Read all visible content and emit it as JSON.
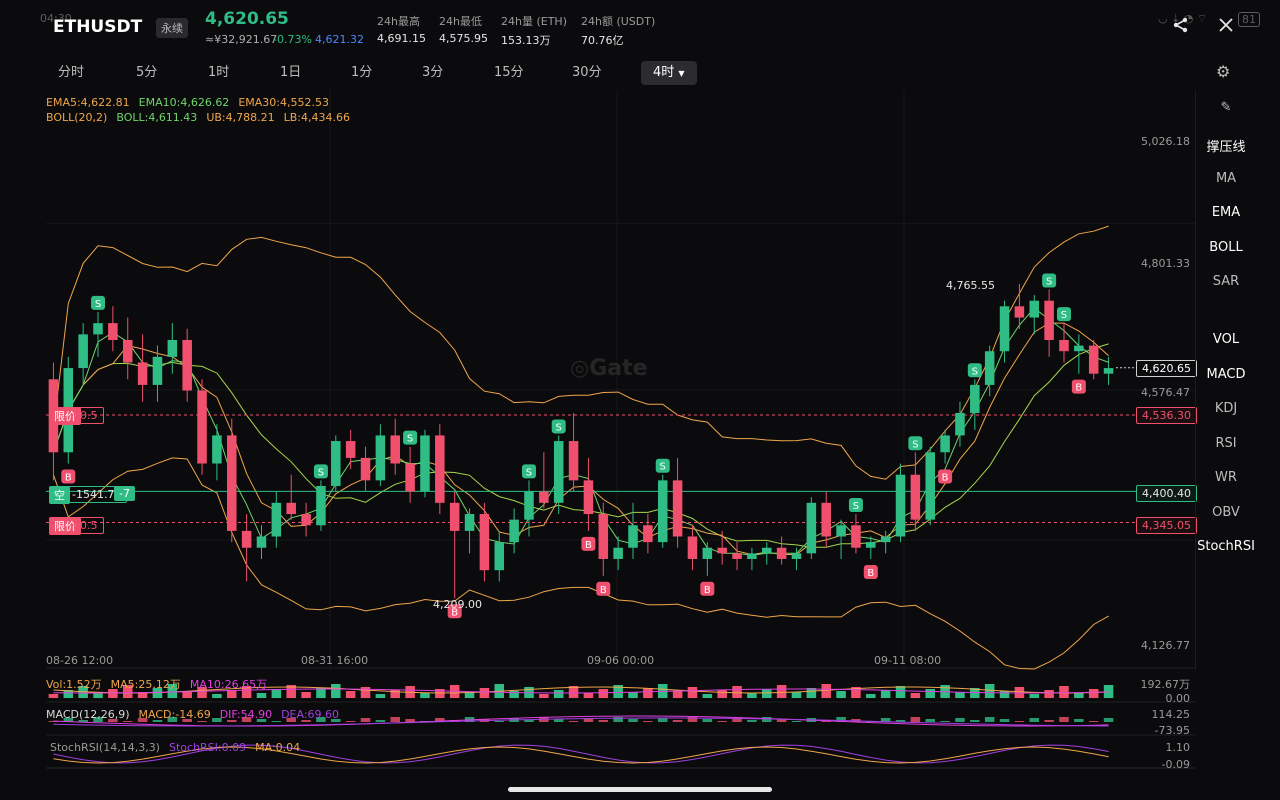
{
  "header": {
    "time": "04:30",
    "symbol": "ETHUSDT",
    "type_badge": "永续",
    "price": "4,620.65",
    "cny": "≈¥32,921.67",
    "change_pct": "-0.73%",
    "mark_price": "4,621.32",
    "stats": [
      {
        "label": "24h最高",
        "value": "4,691.15"
      },
      {
        "label": "24h最低",
        "value": "4,575.95"
      },
      {
        "label": "24h量 (ETH)",
        "value": "153.13万"
      },
      {
        "label": "24h额 (USDT)",
        "value": "70.76亿"
      }
    ],
    "battery": "81"
  },
  "timeframes": [
    "分时",
    "5分",
    "1时",
    "1日",
    "1分",
    "3分",
    "15分",
    "30分",
    "4时"
  ],
  "active_timeframe": "4时",
  "side_tools": [
    "撑压线",
    "MA",
    "EMA",
    "BOLL",
    "SAR",
    "VOL",
    "MACD",
    "KDJ",
    "RSI",
    "WR",
    "OBV",
    "StochRSI"
  ],
  "legends": {
    "ema": [
      "EMA5:4,622.81",
      "EMA10:4,626.62",
      "EMA30:4,552.53"
    ],
    "boll": [
      "BOLL(20,2)",
      "BOLL:4,611.43",
      "UB:4,788.21",
      "LB:4,434.66"
    ],
    "vol": [
      "Vol:1.52万",
      "MA5:25.12万",
      "MA10:26.65万"
    ],
    "macd": [
      "MACD(12,26,9)",
      "MACD:-14.69",
      "DIF:54.90",
      "DEA:69.60"
    ],
    "stoch": [
      "StochRSI(14,14,3,3)",
      "StochRSI:0.09",
      "MA:0.04"
    ]
  },
  "price_axis": [
    "5,026.18",
    "4,801.33",
    "4,576.47",
    "4,126.77"
  ],
  "price_tags": {
    "last": "4,620.65",
    "order_top": "4,536.30",
    "position": "4,400.40",
    "order_bottom": "4,345.05"
  },
  "orders": {
    "limit_label": "限价",
    "limit_qty": "0.5",
    "short_label": "空",
    "short_pnl": "-1541.73",
    "short_qty": "-7"
  },
  "annotations": {
    "high": "4,765.55",
    "low": "4,209.00"
  },
  "time_axis": [
    "08-26 12:00",
    "08-31 16:00",
    "09-06 00:00",
    "09-11 08:00"
  ],
  "vol_axis": [
    "192.67万",
    "0.00"
  ],
  "macd_axis": [
    "114.25",
    "-73.95"
  ],
  "stoch_axis": [
    "1.10",
    "-0.09"
  ],
  "watermark": "Gate",
  "colors": {
    "up": "#2fbd85",
    "down": "#f0506e",
    "ema5": "#f0a64a",
    "ema10": "#6fd66a",
    "boll": "#f0a64a",
    "macd_dif": "#e040e0",
    "stoch": "#a040e0"
  },
  "chart_data": {
    "type": "candlestick",
    "ylim": [
      4126.77,
      5026.18
    ],
    "candles": [
      [
        4600,
        4630,
        4420,
        4470
      ],
      [
        4470,
        4640,
        4450,
        4620
      ],
      [
        4620,
        4700,
        4590,
        4680
      ],
      [
        4680,
        4720,
        4640,
        4700
      ],
      [
        4700,
        4730,
        4650,
        4670
      ],
      [
        4670,
        4710,
        4600,
        4630
      ],
      [
        4630,
        4680,
        4560,
        4590
      ],
      [
        4590,
        4660,
        4560,
        4640
      ],
      [
        4640,
        4700,
        4610,
        4670
      ],
      [
        4670,
        4690,
        4560,
        4580
      ],
      [
        4580,
        4600,
        4430,
        4450
      ],
      [
        4450,
        4520,
        4420,
        4500
      ],
      [
        4500,
        4530,
        4310,
        4330
      ],
      [
        4330,
        4360,
        4240,
        4300
      ],
      [
        4300,
        4340,
        4280,
        4320
      ],
      [
        4320,
        4400,
        4300,
        4380
      ],
      [
        4380,
        4430,
        4350,
        4360
      ],
      [
        4360,
        4380,
        4320,
        4340
      ],
      [
        4340,
        4420,
        4330,
        4410
      ],
      [
        4410,
        4500,
        4400,
        4490
      ],
      [
        4490,
        4510,
        4440,
        4460
      ],
      [
        4460,
        4480,
        4400,
        4420
      ],
      [
        4420,
        4520,
        4410,
        4500
      ],
      [
        4500,
        4530,
        4430,
        4450
      ],
      [
        4450,
        4480,
        4380,
        4400
      ],
      [
        4400,
        4510,
        4390,
        4500
      ],
      [
        4500,
        4520,
        4360,
        4380
      ],
      [
        4380,
        4400,
        4210,
        4330
      ],
      [
        4330,
        4370,
        4290,
        4360
      ],
      [
        4360,
        4380,
        4240,
        4260
      ],
      [
        4260,
        4330,
        4240,
        4310
      ],
      [
        4310,
        4370,
        4290,
        4350
      ],
      [
        4350,
        4420,
        4320,
        4400
      ],
      [
        4400,
        4470,
        4370,
        4380
      ],
      [
        4380,
        4500,
        4360,
        4490
      ],
      [
        4490,
        4540,
        4400,
        4420
      ],
      [
        4420,
        4460,
        4330,
        4360
      ],
      [
        4360,
        4380,
        4250,
        4280
      ],
      [
        4280,
        4320,
        4260,
        4300
      ],
      [
        4300,
        4380,
        4280,
        4340
      ],
      [
        4340,
        4360,
        4290,
        4310
      ],
      [
        4310,
        4430,
        4300,
        4420
      ],
      [
        4420,
        4460,
        4300,
        4320
      ],
      [
        4320,
        4340,
        4260,
        4280
      ],
      [
        4280,
        4310,
        4250,
        4300
      ],
      [
        4300,
        4330,
        4270,
        4290
      ],
      [
        4290,
        4310,
        4260,
        4280
      ],
      [
        4280,
        4300,
        4260,
        4290
      ],
      [
        4290,
        4310,
        4270,
        4300
      ],
      [
        4300,
        4320,
        4270,
        4280
      ],
      [
        4280,
        4300,
        4260,
        4290
      ],
      [
        4290,
        4390,
        4280,
        4380
      ],
      [
        4380,
        4400,
        4300,
        4320
      ],
      [
        4320,
        4350,
        4280,
        4340
      ],
      [
        4340,
        4360,
        4290,
        4300
      ],
      [
        4300,
        4320,
        4280,
        4310
      ],
      [
        4310,
        4330,
        4290,
        4320
      ],
      [
        4320,
        4450,
        4310,
        4430
      ],
      [
        4430,
        4470,
        4330,
        4350
      ],
      [
        4350,
        4480,
        4340,
        4470
      ],
      [
        4470,
        4510,
        4450,
        4500
      ],
      [
        4500,
        4560,
        4480,
        4540
      ],
      [
        4540,
        4600,
        4510,
        4590
      ],
      [
        4590,
        4660,
        4570,
        4650
      ],
      [
        4650,
        4740,
        4630,
        4730
      ],
      [
        4730,
        4770,
        4690,
        4710
      ],
      [
        4710,
        4750,
        4680,
        4740
      ],
      [
        4740,
        4760,
        4640,
        4670
      ],
      [
        4670,
        4700,
        4630,
        4650
      ],
      [
        4650,
        4680,
        4610,
        4660
      ],
      [
        4660,
        4670,
        4600,
        4610
      ],
      [
        4610,
        4640,
        4590,
        4620
      ]
    ],
    "signals": [
      {
        "i": 3,
        "t": "S"
      },
      {
        "i": 1,
        "t": "B"
      },
      {
        "i": 18,
        "t": "S"
      },
      {
        "i": 24,
        "t": "S"
      },
      {
        "i": 27,
        "t": "B"
      },
      {
        "i": 32,
        "t": "S"
      },
      {
        "i": 34,
        "t": "S"
      },
      {
        "i": 36,
        "t": "B"
      },
      {
        "i": 37,
        "t": "B"
      },
      {
        "i": 41,
        "t": "S"
      },
      {
        "i": 44,
        "t": "B"
      },
      {
        "i": 54,
        "t": "S"
      },
      {
        "i": 55,
        "t": "B"
      },
      {
        "i": 58,
        "t": "S"
      },
      {
        "i": 60,
        "t": "B"
      },
      {
        "i": 62,
        "t": "S"
      },
      {
        "i": 67,
        "t": "S"
      },
      {
        "i": 68,
        "t": "S"
      },
      {
        "i": 69,
        "t": "B"
      }
    ]
  }
}
